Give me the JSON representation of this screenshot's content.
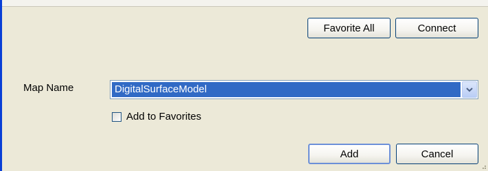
{
  "toolbar": {
    "favorite_all_label": "Favorite All",
    "connect_label": "Connect"
  },
  "form": {
    "map_name_label": "Map Name",
    "map_name_value": "DigitalSurfaceModel",
    "add_to_favorites_label": "Add to Favorites",
    "add_to_favorites_checked": false
  },
  "footer": {
    "add_label": "Add",
    "cancel_label": "Cancel"
  },
  "icons": {
    "dropdown": "chevron-down-icon",
    "resize": "resize-grip-icon"
  },
  "colors": {
    "window_border": "#0a3fd6",
    "background": "#ece9d8",
    "selection": "#316ac5"
  }
}
